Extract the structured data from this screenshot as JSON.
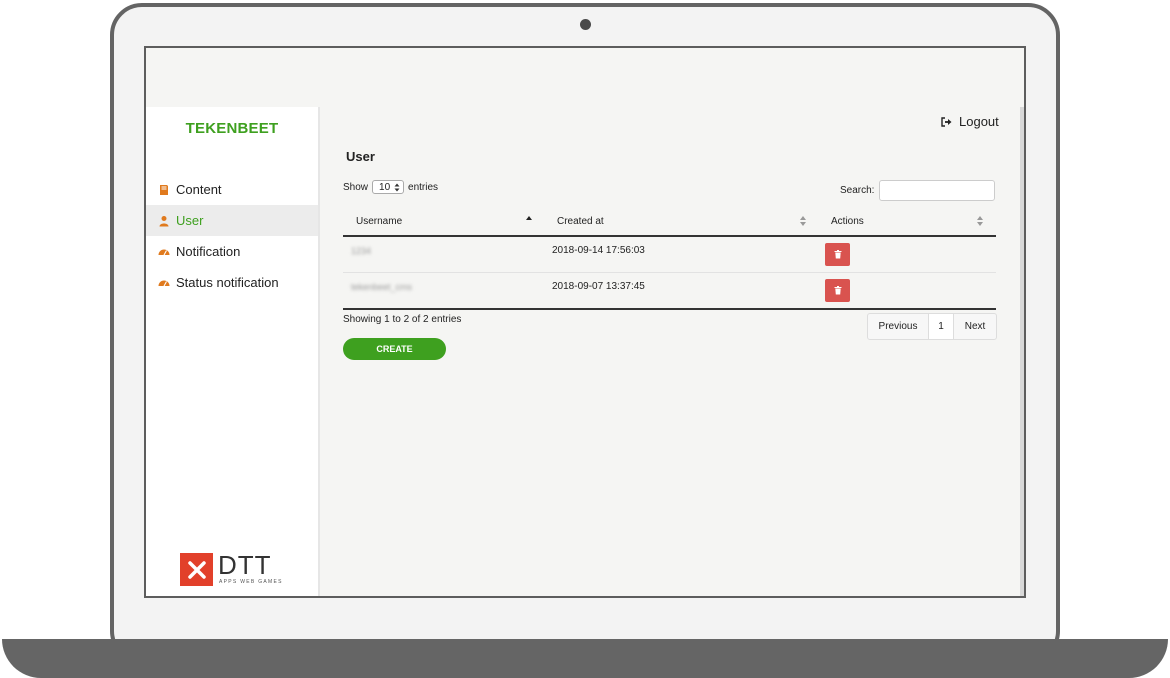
{
  "app": {
    "brand": "TEKENBEET",
    "logout_label": "Logout"
  },
  "sidebar": {
    "items": [
      {
        "label": "Content",
        "icon": "book-icon",
        "active": false
      },
      {
        "label": "User",
        "icon": "user-icon",
        "active": true
      },
      {
        "label": "Notification",
        "icon": "dashboard-icon",
        "active": false
      },
      {
        "label": "Status notification",
        "icon": "dashboard-icon",
        "active": false
      }
    ],
    "footer_logo": {
      "text": "DTT",
      "tagline": "APPS WEB GAMES"
    }
  },
  "main": {
    "title": "User",
    "show_label": "Show",
    "entries_label": "entries",
    "page_length": "10",
    "search_label": "Search:",
    "search_value": "",
    "columns": [
      "Username",
      "Created at",
      "Actions"
    ],
    "rows": [
      {
        "username": "1234",
        "created_at": "2018-09-14 17:56:03"
      },
      {
        "username": "tekenbeet_cms",
        "created_at": "2018-09-07 13:37:45"
      }
    ],
    "info": "Showing 1 to 2 of 2 entries",
    "pagination": {
      "previous": "Previous",
      "current": "1",
      "next": "Next"
    },
    "create_label": "CREATE"
  },
  "colors": {
    "brand_green": "#3ea01f",
    "delete_red": "#d9534f",
    "dtt_red": "#e2402a"
  }
}
